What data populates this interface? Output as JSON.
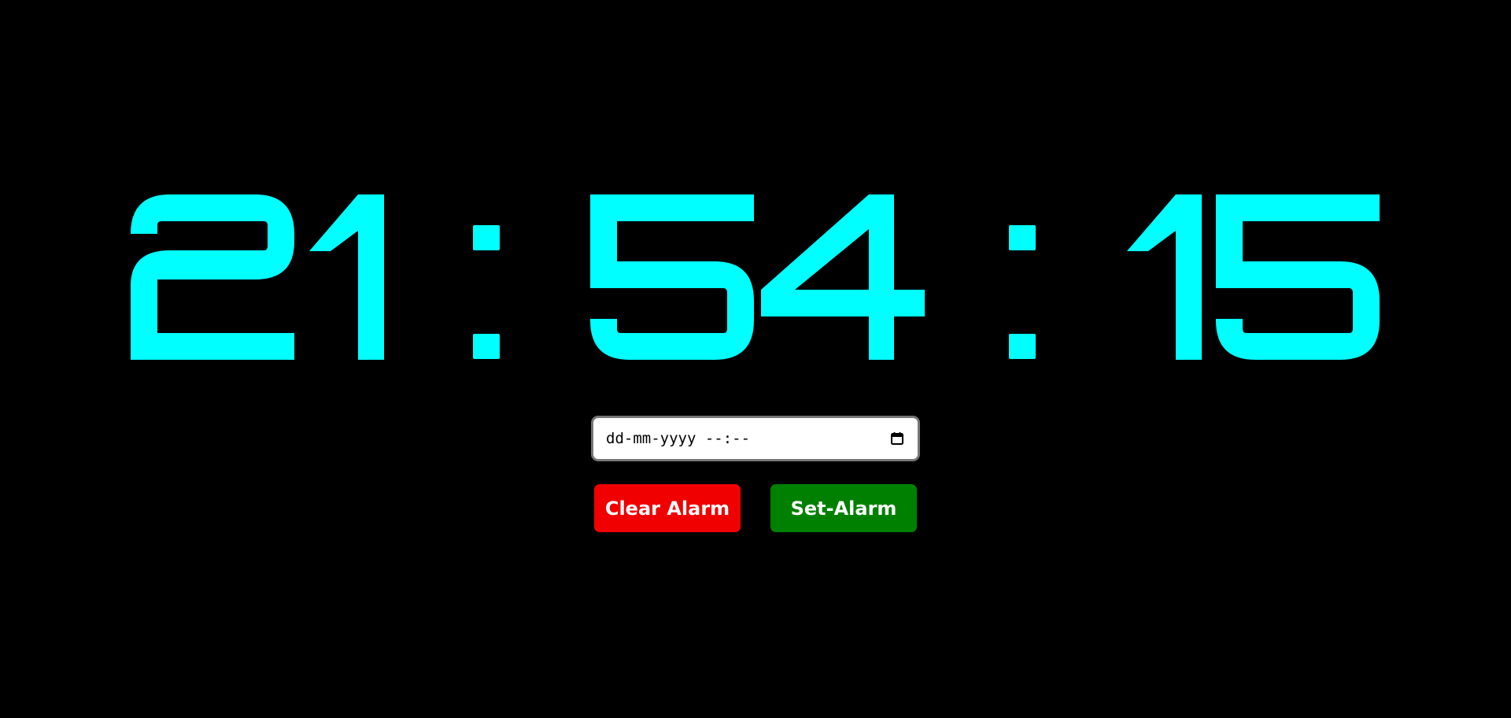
{
  "clock": {
    "hours": "21",
    "minutes": "54",
    "seconds": "15",
    "separator": ":",
    "digit_color": "#00ffff"
  },
  "alarm": {
    "input_value": "dd-mm-yyyy --:--",
    "calendar_icon": "calendar-icon"
  },
  "buttons": {
    "clear_label": "Clear Alarm",
    "clear_color": "#f00000",
    "set_label": "Set-Alarm",
    "set_color": "#008000"
  },
  "background": "#000000"
}
